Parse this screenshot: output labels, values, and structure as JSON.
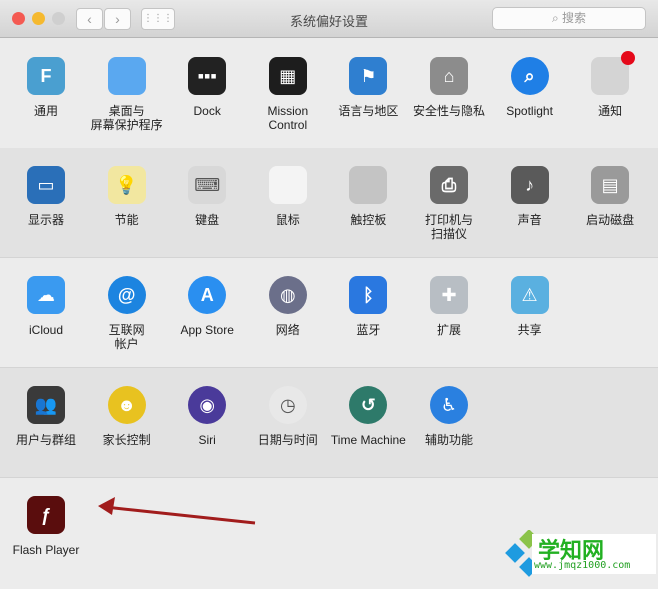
{
  "window": {
    "title": "系统偏好设置",
    "search_placeholder": "搜索",
    "back": "‹",
    "forward": "›",
    "grid": "⋮⋮⋮"
  },
  "sections": [
    [
      {
        "label": "通用",
        "icon": "general-icon",
        "color": "#4a9fd0",
        "glyph": "F"
      },
      {
        "label": "桌面与\n屏幕保护程序",
        "icon": "desktop-icon",
        "color": "#5aa8f0",
        "glyph": ""
      },
      {
        "label": "Dock",
        "icon": "dock-icon",
        "color": "#222222",
        "glyph": "▪▪▪"
      },
      {
        "label": "Mission\nControl",
        "icon": "mission-control-icon",
        "color": "#1d1d1d",
        "glyph": "▦"
      },
      {
        "label": "语言与地区",
        "icon": "flag-icon",
        "color": "#2f7fd0",
        "glyph": "⚑"
      },
      {
        "label": "安全性与隐私",
        "icon": "house-lock-icon",
        "color": "#8c8c8c",
        "glyph": "⌂"
      },
      {
        "label": "Spotlight",
        "icon": "spotlight-icon",
        "color": "#1f7fe6",
        "glyph": "⌕"
      },
      {
        "label": "通知",
        "icon": "notifications-icon",
        "color": "#d4d4d4",
        "glyph": ""
      }
    ],
    [
      {
        "label": "显示器",
        "icon": "display-icon",
        "color": "#2a6fb8",
        "glyph": "▭"
      },
      {
        "label": "节能",
        "icon": "bulb-icon",
        "color": "#f2e7a0",
        "glyph": "💡"
      },
      {
        "label": "键盘",
        "icon": "keyboard-icon",
        "color": "#d8d8d8",
        "glyph": "⌨"
      },
      {
        "label": "鼠标",
        "icon": "mouse-icon",
        "color": "#f4f4f4",
        "glyph": ""
      },
      {
        "label": "触控板",
        "icon": "trackpad-icon",
        "color": "#c4c4c4",
        "glyph": ""
      },
      {
        "label": "打印机与\n扫描仪",
        "icon": "printer-icon",
        "color": "#6a6a6a",
        "glyph": "⎙"
      },
      {
        "label": "声音",
        "icon": "speaker-icon",
        "color": "#5a5a5a",
        "glyph": "♪"
      },
      {
        "label": "启动磁盘",
        "icon": "disk-icon",
        "color": "#9a9a9a",
        "glyph": "▤"
      }
    ],
    [
      {
        "label": "iCloud",
        "icon": "icloud-icon",
        "color": "#3a9af0",
        "glyph": "☁"
      },
      {
        "label": "互联网\n帐户",
        "icon": "at-icon",
        "color": "#1c84e0",
        "glyph": "@"
      },
      {
        "label": "App Store",
        "icon": "app-store-icon",
        "color": "#2a8ff0",
        "glyph": "A"
      },
      {
        "label": "网络",
        "icon": "globe-icon",
        "color": "#6b6f8a",
        "glyph": "◍"
      },
      {
        "label": "蓝牙",
        "icon": "bluetooth-icon",
        "color": "#2a78e0",
        "glyph": "ᛒ"
      },
      {
        "label": "扩展",
        "icon": "puzzle-icon",
        "color": "#b8bec4",
        "glyph": "✚"
      },
      {
        "label": "共享",
        "icon": "shared-folder-icon",
        "color": "#5ab0e0",
        "glyph": "⚠"
      }
    ],
    [
      {
        "label": "用户与群组",
        "icon": "users-icon",
        "color": "#3a3a3a",
        "glyph": "👥"
      },
      {
        "label": "家长控制",
        "icon": "parental-icon",
        "color": "#e8c220",
        "glyph": "☻"
      },
      {
        "label": "Siri",
        "icon": "siri-icon",
        "color": "#4a3a9a",
        "glyph": "◉"
      },
      {
        "label": "日期与时间",
        "icon": "clock-icon",
        "color": "#e8e8e8",
        "glyph": "◷"
      },
      {
        "label": "Time Machine",
        "icon": "time-machine-icon",
        "color": "#2e7a6a",
        "glyph": "↺"
      },
      {
        "label": "辅助功能",
        "icon": "accessibility-icon",
        "color": "#2a80e0",
        "glyph": "♿"
      }
    ],
    [
      {
        "label": "Flash Player",
        "icon": "flash-icon",
        "color": "#5a0d0d",
        "glyph": "ƒ"
      }
    ]
  ],
  "watermark": {
    "title": "学知网",
    "url": "www.jmqz1000.com"
  }
}
